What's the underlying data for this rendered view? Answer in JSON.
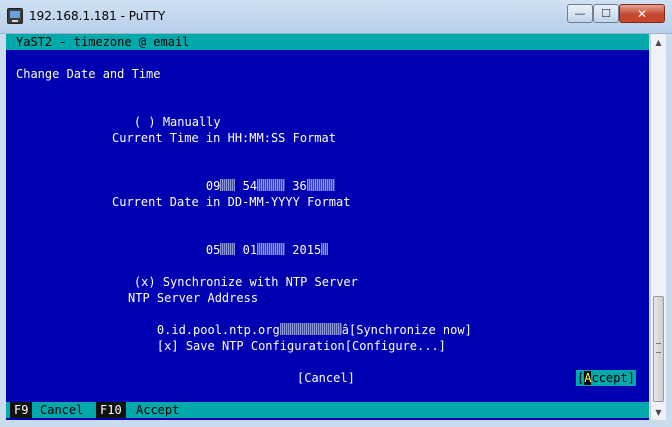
{
  "window": {
    "title": "192.168.1.181 - PuTTY",
    "minimize_icon": "minimize-icon",
    "maximize_icon": "maximize-icon",
    "close_icon": "close-icon",
    "min_glyph": "—",
    "max_glyph": "☐",
    "close_glyph": "✕"
  },
  "terminal": {
    "header": "YaST2 - timezone @ email",
    "section_title": "Change Date and Time",
    "manual_radio": "( )",
    "manual_label": " Manually",
    "time_format_label": "Current Time in HH:MM:SS Format",
    "time_hour": "09",
    "time_minute": "54",
    "time_second": "36",
    "date_format_label": "Current Date in DD-MM-YYYY Format",
    "date_day": "05",
    "date_month": "01",
    "date_year": "2015",
    "ntp_radio": "(x)",
    "ntp_label": " Synchronize with NTP Server",
    "ntp_address_label": "NTP Server Address",
    "ntp_address_value": "0.id.pool.ntp.org",
    "ntp_dropdown_arrow": "â",
    "sync_button": "[Synchronize now]",
    "save_checkbox": "[x]",
    "save_label": " Save NTP Configuration",
    "configure_button": "[Configure...]",
    "cancel_button": "[Cancel]",
    "accept_button_left": "[",
    "accept_button_hot": "A",
    "accept_button_rest": "ccept]"
  },
  "footer": {
    "cancel_key": "F9",
    "cancel_label": "Cancel",
    "accept_key": "F10",
    "accept_label": "Accept"
  },
  "scrollbar": {
    "up_glyph": "▲",
    "down_glyph": "▼"
  },
  "colors": {
    "terminal_bg": "#0000b3",
    "header_bar": "#00aaaa",
    "text": "#ffffff"
  }
}
